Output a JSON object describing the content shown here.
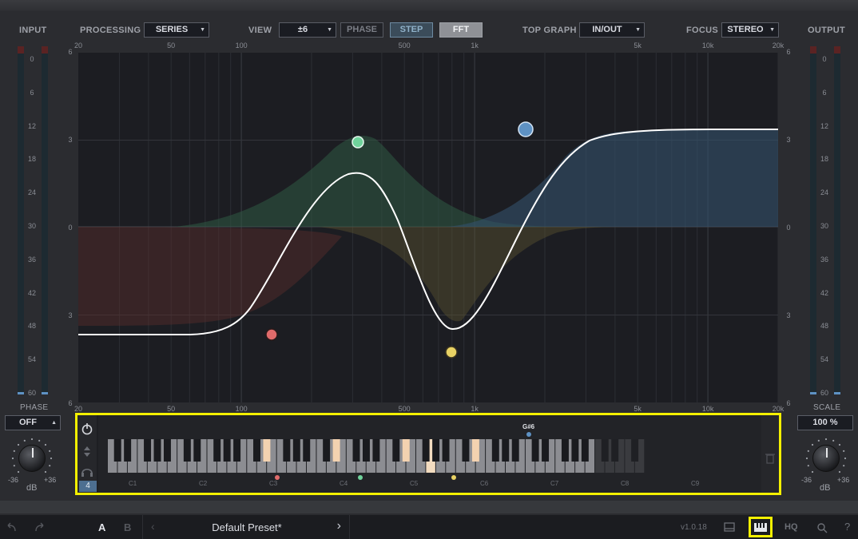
{
  "header": {
    "input_label": "INPUT",
    "processing_label": "PROCESSING",
    "processing_value": "SERIES",
    "view_label": "VIEW",
    "view_value": "±6",
    "phase_btn": "PHASE",
    "step_btn": "STEP",
    "fft_btn": "FFT",
    "topgraph_label": "TOP GRAPH",
    "topgraph_value": "IN/OUT",
    "focus_label": "FOCUS",
    "focus_value": "STEREO",
    "output_label": "OUTPUT"
  },
  "meters": {
    "ticks": [
      "0",
      "6",
      "12",
      "18",
      "24",
      "30",
      "36",
      "42",
      "48",
      "54",
      "60"
    ]
  },
  "graph": {
    "freq_labels": [
      "20",
      "50",
      "100",
      "500",
      "1k",
      "5k",
      "10k",
      "20k"
    ],
    "db_labels": [
      "6",
      "3",
      "0",
      "3",
      "6"
    ]
  },
  "left_panel": {
    "phase_label": "PHASE",
    "phase_value": "OFF",
    "knob_min": "-36",
    "knob_max": "+36",
    "unit": "dB"
  },
  "right_panel": {
    "scale_label": "SCALE",
    "scale_value": "100 %",
    "knob_min": "-36",
    "knob_max": "+36",
    "unit": "dB"
  },
  "keyboard": {
    "octave_value": "4",
    "octaves": [
      "C1",
      "C2",
      "C3",
      "C4",
      "C5",
      "C6",
      "C7",
      "C8",
      "C9"
    ],
    "note_tag": "G#6"
  },
  "footer": {
    "a_label": "A",
    "b_label": "B",
    "preset_name": "Default Preset*",
    "version": "v1.0.18",
    "hq_label": "HQ",
    "help_label": "?"
  },
  "colors": {
    "accent_yellow": "#f4f000",
    "band_red": "#e06b6b",
    "band_green": "#6fd39b",
    "band_yellow": "#e8d264",
    "band_blue": "#5e92c4"
  }
}
